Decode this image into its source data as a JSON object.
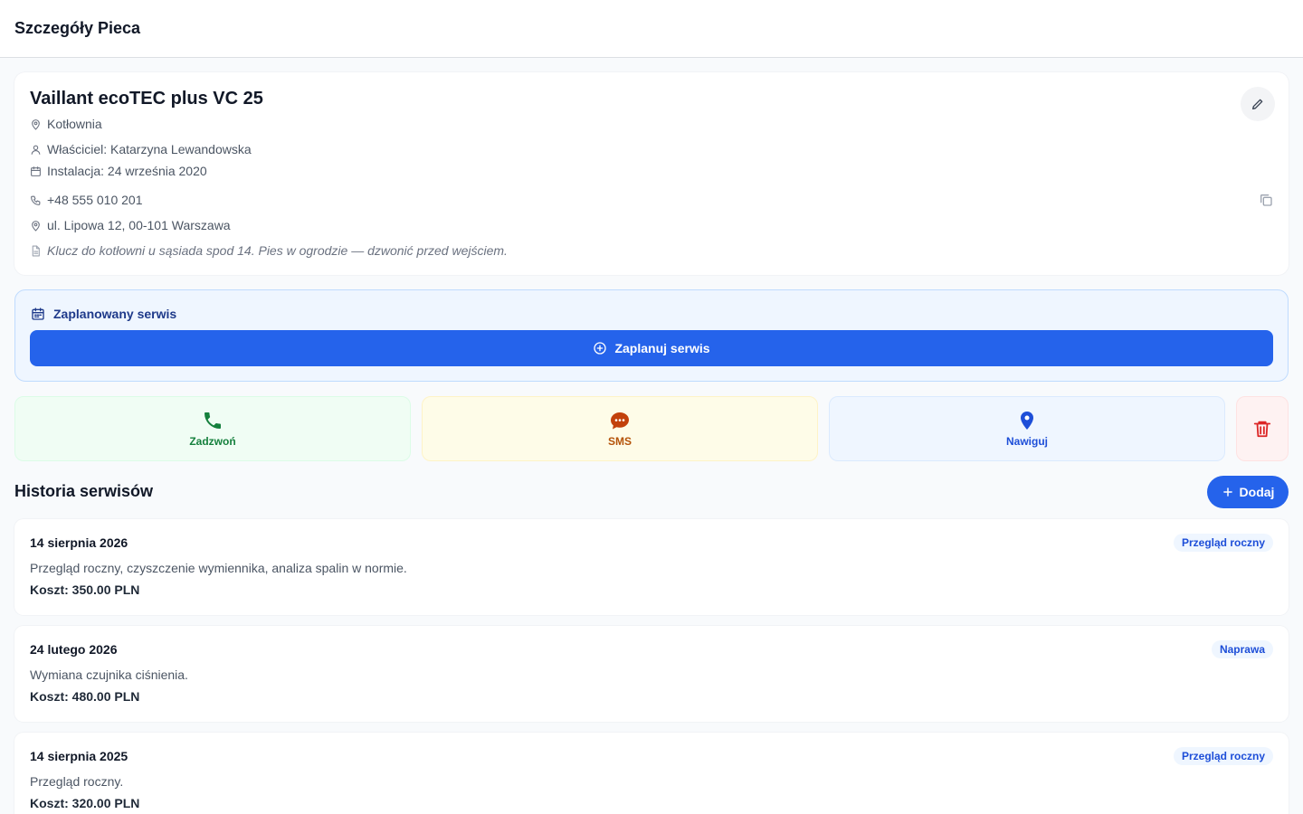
{
  "header": {
    "title": "Szczegóły Pieca"
  },
  "device": {
    "name": "Vaillant ecoTEC plus VC 25",
    "location": "Kotłownia",
    "owner": "Właściciel: Katarzyna Lewandowska",
    "installation": "Instalacja: 24 września 2020",
    "phone": "+48 555 010 201",
    "address": "ul. Lipowa 12, 00-101 Warszawa",
    "note": "Klucz do kotłowni u sąsiada spod 14. Pies w ogrodzie — dzwonić przed wejściem."
  },
  "schedule": {
    "title": "Zaplanowany serwis",
    "button_label": "Zaplanuj serwis"
  },
  "actions": {
    "call": "Zadzwoń",
    "sms": "SMS",
    "navigate": "Nawiguj"
  },
  "history": {
    "title": "Historia serwisów",
    "add_label": "Dodaj",
    "entries": [
      {
        "date": "14 sierpnia 2026",
        "type": "Przegląd roczny",
        "description": "Przegląd roczny, czyszczenie wymiennika, analiza spalin w normie.",
        "cost": "Koszt: 350.00 PLN"
      },
      {
        "date": "24 lutego 2026",
        "type": "Naprawa",
        "description": "Wymiana czujnika ciśnienia.",
        "cost": "Koszt: 480.00 PLN"
      },
      {
        "date": "14 sierpnia 2025",
        "type": "Przegląd roczny",
        "description": "Przegląd roczny.",
        "cost": "Koszt: 320.00 PLN"
      }
    ]
  },
  "colors": {
    "primary": "#2563eb",
    "call": "#15803d",
    "sms": "#c2410c",
    "navigate": "#1d4ed8",
    "delete": "#dc2626"
  },
  "icons": {
    "edit": "pencil-icon",
    "location": "map-pin-icon",
    "owner": "user-icon",
    "installation": "calendar-icon",
    "phone": "phone-icon",
    "note": "document-icon",
    "copy": "copy-icon",
    "schedule": "calendar-icon",
    "schedule_button": "plus-circle-icon",
    "call": "phone-icon",
    "sms": "chat-bubble-icon",
    "navigate": "map-pin-icon",
    "delete": "trash-icon",
    "add": "plus-icon"
  }
}
